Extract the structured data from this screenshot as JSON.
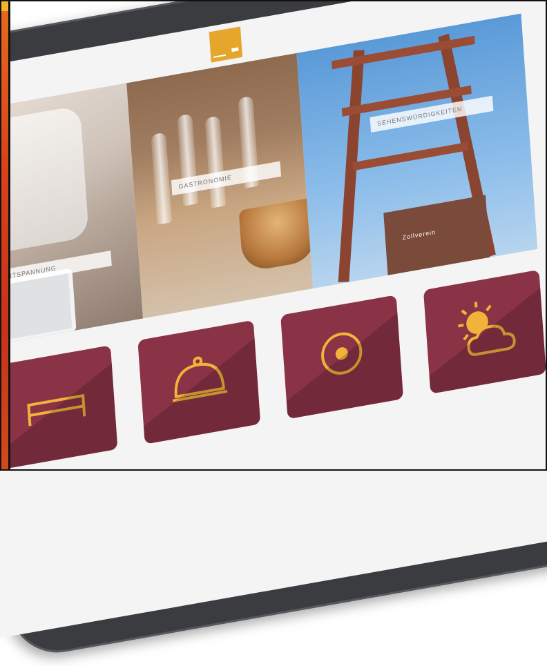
{
  "screen": {
    "logo_text": "",
    "tiles": [
      {
        "label": "Entspannung",
        "scene": "hotel bed and tablet"
      },
      {
        "label": "Gastronomie",
        "scene": "wine glasses and bread basket"
      },
      {
        "label": "Sehenswürdigkeiten",
        "building_label": "Zollverein",
        "scene": "mining headframe tower"
      }
    ],
    "icon_tiles": [
      {
        "icon": "bed-icon"
      },
      {
        "icon": "cloche-icon"
      },
      {
        "icon": "camera-icon"
      },
      {
        "icon": "weather-sun-cloud-icon"
      }
    ]
  },
  "colors": {
    "accent": "#e6a52b",
    "icon_tile": "#8b3346",
    "icon_stroke": "#f0b43a",
    "left_strip": "#d7431a",
    "tablet_bezel": "#3a3c40"
  }
}
